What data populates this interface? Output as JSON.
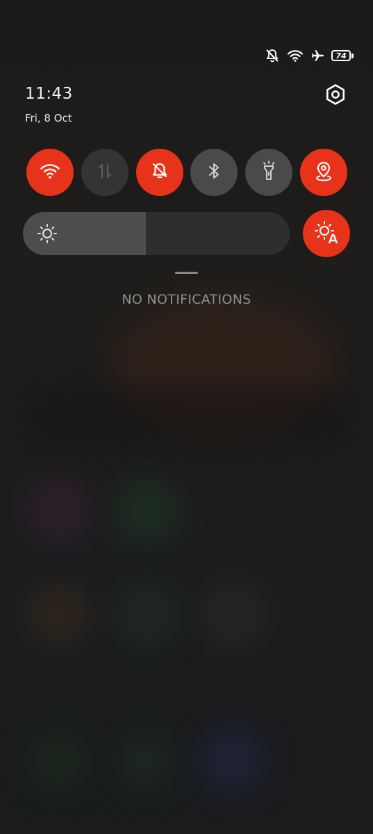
{
  "status_bar": {
    "icons": [
      "mute-icon",
      "wifi-icon",
      "airplane-icon"
    ],
    "battery_level": "74"
  },
  "header": {
    "time": "11:43",
    "date": "Fri, 8 Oct",
    "settings_icon": "gear-icon"
  },
  "quick_toggles": [
    {
      "icon": "wifi-icon",
      "state": "on"
    },
    {
      "icon": "mobile-data-icon",
      "state": "disabled"
    },
    {
      "icon": "silent-bell-icon",
      "state": "on"
    },
    {
      "icon": "bluetooth-icon",
      "state": "off"
    },
    {
      "icon": "flashlight-icon",
      "state": "off"
    },
    {
      "icon": "location-icon",
      "state": "on"
    }
  ],
  "brightness": {
    "level": 0.46,
    "auto_icon": "auto-brightness-icon"
  },
  "notifications": {
    "empty_text": "NO NOTIFICATIONS"
  },
  "colors": {
    "accent": "#e8331b",
    "toggle_off": "#4a4a4a",
    "toggle_disabled": "#343434",
    "background": "#1c1b1a"
  }
}
